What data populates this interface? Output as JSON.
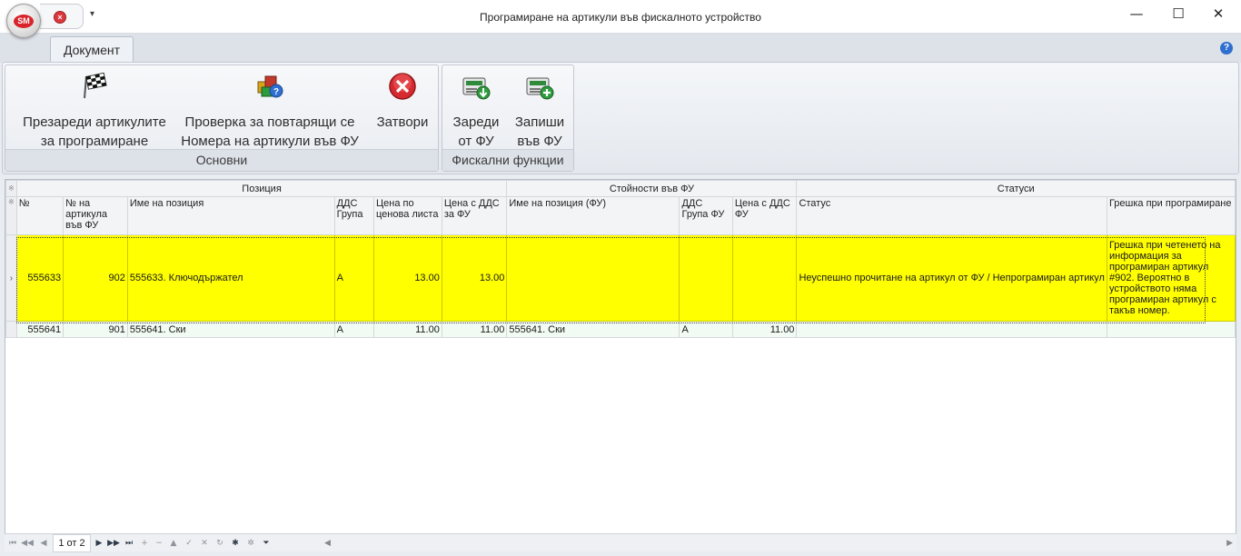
{
  "window": {
    "title": "Програмиране на артикули във фискалното устройство",
    "logo_text": "SM",
    "minimize": "—",
    "maximize": "☐",
    "close": "✕"
  },
  "ribbon": {
    "tab": "Документ",
    "groups": {
      "main": {
        "label": "Основни",
        "reload": [
          "Презареди артикулите",
          "за програмиране"
        ],
        "check": [
          "Проверка за повтарящи се",
          "Номера на артикули във ФУ"
        ],
        "close": "Затвори"
      },
      "fiscal": {
        "label": "Фискални функции",
        "load": [
          "Зареди",
          "от ФУ"
        ],
        "write": [
          "Запиши",
          "във ФУ"
        ]
      }
    }
  },
  "grid": {
    "bands": [
      "Позиция",
      "Стойности във ФУ",
      "Статуси"
    ],
    "columns": [
      "№",
      "№ на артикула във ФУ",
      "Име на позиция",
      "ДДС Група",
      "Цена по ценова листа",
      "Цена с ДДС за ФУ",
      "Име на позиция (ФУ)",
      "ДДС Група ФУ",
      "Цена с ДДС ФУ",
      "Статус",
      "Грешка при програмиране"
    ],
    "rows": [
      {
        "no": "555633",
        "fu_no": "902",
        "name": "555633. Ключодържател",
        "vat": "A",
        "price": "13.00",
        "price_fu": "13.00",
        "name_fu": "",
        "vat_fu": "",
        "price_in_fu": "",
        "status": "Неуспешно прочитане на артикул от ФУ / Непрограмиран артикул",
        "error": "Грешка при четенето на информация за програмиран артикул #902. Вероятно в устройството няма програмиран артикул с такъв номер."
      },
      {
        "no": "555641",
        "fu_no": "901",
        "name": "555641. Ски",
        "vat": "A",
        "price": "11.00",
        "price_fu": "11.00",
        "name_fu": "555641. Ски",
        "vat_fu": "A",
        "price_in_fu": "11.00",
        "status": "",
        "error": ""
      }
    ]
  },
  "navigator": {
    "record_info": "1 от 2"
  },
  "colors": {
    "selected_row": "#ffff00",
    "alt_row": "#f2fbf3"
  }
}
